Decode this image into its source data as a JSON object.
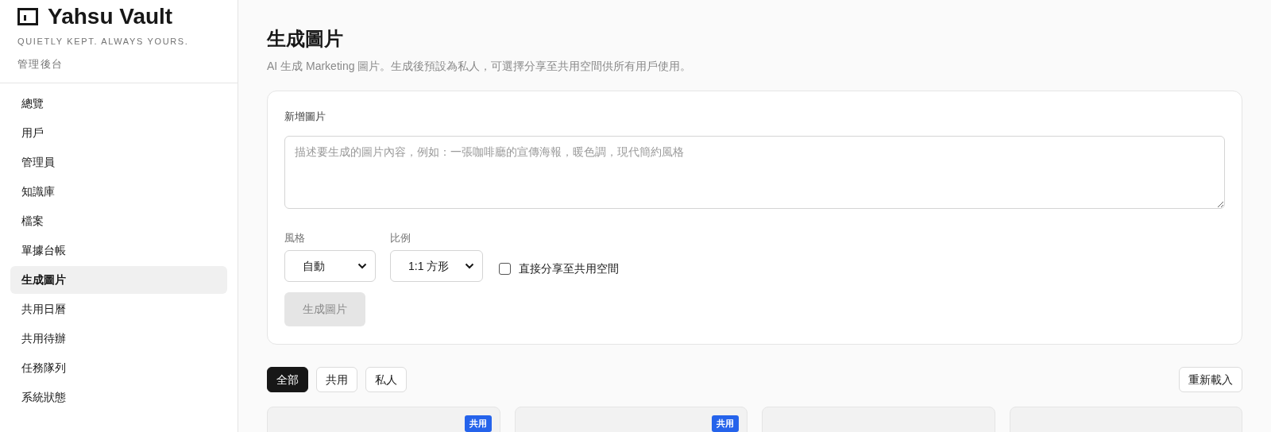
{
  "sidebar": {
    "brand": "Yahsu Vault",
    "tagline": "QUIETLY KEPT. ALWAYS YOURS.",
    "section": "管理後台",
    "items": [
      {
        "label": "總覽",
        "selected": false
      },
      {
        "label": "用戶",
        "selected": false
      },
      {
        "label": "管理員",
        "selected": false
      },
      {
        "label": "知識庫",
        "selected": false
      },
      {
        "label": "檔案",
        "selected": false
      },
      {
        "label": "單據台帳",
        "selected": false
      },
      {
        "label": "生成圖片",
        "selected": true
      },
      {
        "label": "共用日曆",
        "selected": false
      },
      {
        "label": "共用待辦",
        "selected": false
      },
      {
        "label": "任務隊列",
        "selected": false
      },
      {
        "label": "系統狀態",
        "selected": false
      }
    ]
  },
  "page": {
    "title": "生成圖片",
    "subtitle": "AI 生成 Marketing 圖片。生成後預設為私人，可選擇分享至共用空間供所有用戶使用。"
  },
  "form": {
    "title": "新增圖片",
    "prompt": {
      "placeholder": "描述要生成的圖片內容，例如：一張咖啡廳的宣傳海報，暖色調，現代簡約風格"
    },
    "style": {
      "label": "風格",
      "value": "自動"
    },
    "ratio": {
      "label": "比例",
      "value": "1:1 方形"
    },
    "share": {
      "label": "直接分享至共用空間",
      "checked": false
    },
    "submit": {
      "label": "生成圖片",
      "disabled": true
    }
  },
  "filters": [
    {
      "label": "全部",
      "selected": true
    },
    {
      "label": "共用",
      "selected": false
    },
    {
      "label": "私人",
      "selected": false
    }
  ],
  "reload": "重新載入",
  "images": [
    {
      "shared": true,
      "badge": "共用"
    },
    {
      "shared": true,
      "badge": "共用"
    },
    {
      "shared": false
    },
    {
      "shared": false
    }
  ]
}
